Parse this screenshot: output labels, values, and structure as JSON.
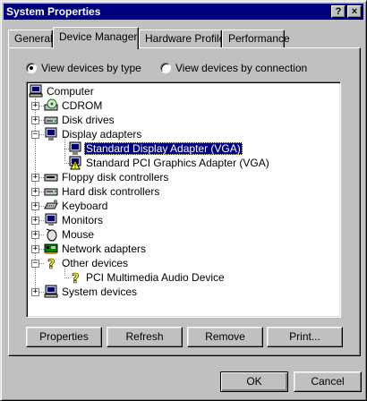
{
  "window": {
    "title": "System Properties",
    "help_button": "?",
    "close_button": "×"
  },
  "tabs": [
    {
      "label": "General",
      "active": false
    },
    {
      "label": "Device Manager",
      "active": true
    },
    {
      "label": "Hardware Profiles",
      "active": false
    },
    {
      "label": "Performance",
      "active": false
    }
  ],
  "view_options": {
    "by_type_label": "View devices by type",
    "by_connection_label": "View devices by connection",
    "selected": "by_type"
  },
  "tree": {
    "root": "Computer",
    "items": [
      {
        "label": "CDROM",
        "icon": "cdrom-icon",
        "expanded": false
      },
      {
        "label": "Disk drives",
        "icon": "disk-drive-icon",
        "expanded": false
      },
      {
        "label": "Display adapters",
        "icon": "display-adapter-icon",
        "expanded": true,
        "children": [
          {
            "label": "Standard Display Adapter (VGA)",
            "icon": "display-adapter-icon",
            "selected": true,
            "warning": false
          },
          {
            "label": "Standard PCI Graphics Adapter (VGA)",
            "icon": "display-adapter-icon",
            "selected": false,
            "warning": true
          }
        ]
      },
      {
        "label": "Floppy disk controllers",
        "icon": "floppy-controller-icon",
        "expanded": false
      },
      {
        "label": "Hard disk controllers",
        "icon": "hdd-controller-icon",
        "expanded": false
      },
      {
        "label": "Keyboard",
        "icon": "keyboard-icon",
        "expanded": false
      },
      {
        "label": "Monitors",
        "icon": "monitor-icon",
        "expanded": false
      },
      {
        "label": "Mouse",
        "icon": "mouse-icon",
        "expanded": false
      },
      {
        "label": "Network adapters",
        "icon": "network-adapter-icon",
        "expanded": false
      },
      {
        "label": "Other devices",
        "icon": "unknown-device-icon",
        "expanded": true,
        "children": [
          {
            "label": "PCI Multimedia Audio Device",
            "icon": "unknown-device-icon",
            "selected": false,
            "warning": false
          }
        ]
      },
      {
        "label": "System devices",
        "icon": "system-device-icon",
        "expanded": false
      }
    ]
  },
  "buttons": {
    "properties": "Properties",
    "refresh": "Refresh",
    "remove": "Remove",
    "print": "Print...",
    "ok": "OK",
    "cancel": "Cancel"
  },
  "colors": {
    "face": "#c0c0c0",
    "title_bar": "#000080",
    "selection": "#000080"
  }
}
